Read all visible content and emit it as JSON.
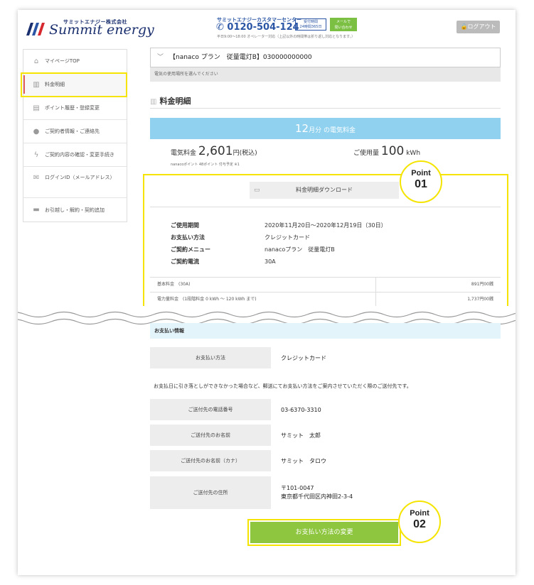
{
  "header": {
    "logo_sub": "サミットエナジー株式会社",
    "logo_main": "Summit energy",
    "cc_label": "サミットエナジーカスタマーセンター",
    "cc_phone": "0120-504-124",
    "cc_badge_top": "受付時間",
    "cc_badge_bottom": "24時間365日",
    "cc_mail_top": "メールで",
    "cc_mail_bottom": "問い合わせ",
    "cc_note": "平日9:00～18:00 オペレーター対応（上記以外の時間帯は折り返し対応となります。）",
    "logout": "ログアウト"
  },
  "sidebar": {
    "items": [
      {
        "label": "マイページTOP",
        "icon": "home-icon"
      },
      {
        "label": "料金明細",
        "icon": "bar-chart-icon"
      },
      {
        "label": "ポイント履歴・登録変更",
        "icon": "card-icon"
      },
      {
        "label": "ご契約者情報・ご連絡先",
        "icon": "person-icon"
      },
      {
        "label": "ご契約内容の確認・変更手続き",
        "icon": "bolt-icon"
      },
      {
        "label": "ログインID（メールアドレス）",
        "icon": "mail-icon"
      },
      {
        "label": "お引越し・解約・契約追加",
        "icon": "truck-icon"
      }
    ]
  },
  "contract": {
    "selector": "【nanaco プラン　従量電灯B】030000000000",
    "note": "電気の使用場所を選んでください"
  },
  "section_title": "料金明細",
  "bill": {
    "month_num": "12",
    "month_suffix": "月分",
    "month_label": "の電気料金",
    "charge_label": "電気料金",
    "charge_value": "2,601",
    "charge_unit": "円(税込)",
    "usage_label": "ご使用量",
    "usage_value": "100",
    "usage_unit": "kWh",
    "points_note": "nanacoポイント 48ポイント 付与予定 ※1",
    "download_label": "料金明細ダウンロード"
  },
  "details": [
    {
      "k": "ご使用期間",
      "v": "2020年11月20日～2020年12月19日（30日）"
    },
    {
      "k": "お支払い方法",
      "v": "クレジットカード"
    },
    {
      "k": "ご契約メニュー",
      "v": "nanacoプラン　従量電灯B"
    },
    {
      "k": "ご契約電流",
      "v": "30A"
    }
  ],
  "fees": [
    {
      "k": "基本料金　(30A)",
      "v": "891円00銭"
    },
    {
      "k": "電力量料金　(1段階料金 0 kWh ～ 120 kWh まで)",
      "v": "1,737円00銭"
    }
  ],
  "points": [
    {
      "title": "Point",
      "num": "01"
    },
    {
      "title": "Point",
      "num": "02"
    }
  ],
  "payment": {
    "heading": "お支払い情報",
    "method_label": "お支払い方法",
    "method_value": "クレジットカード",
    "note": "お支払日に引き落としができなかった場合など、郵送にてお支払い方法をご案内させていただく際のご送付先です。",
    "rows": [
      {
        "k": "ご送付先の電話番号",
        "v": "03-6370-3310"
      },
      {
        "k": "ご送付先のお名前",
        "v": "サミット　太郎"
      },
      {
        "k": "ご送付先のお名前（カナ）",
        "v": "サミット　タロウ"
      }
    ],
    "address_label": "ご送付先の住所",
    "address_zip": "〒101-0047",
    "address_line": "東京都千代田区内神田2-3-4",
    "change_button": "お支払い方法の変更"
  }
}
